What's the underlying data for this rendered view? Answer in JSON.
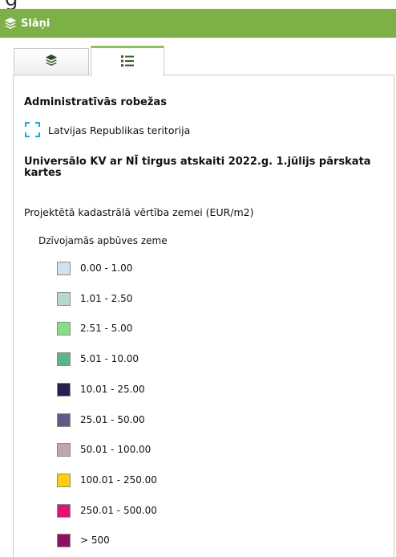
{
  "panel": {
    "title": "Slāņi"
  },
  "tabs": [
    {
      "icon": "layers-icon",
      "active": false
    },
    {
      "icon": "legend-list-icon",
      "active": true
    }
  ],
  "legend": {
    "section1_title": "Administratīvās robežas",
    "boundary_label": "Latvijas Republikas teritorija",
    "section2_title": "Universālo KV ar NĪ tirgus atskaiti 2022.g. 1.jūlijs pārskata kartes",
    "value_title": "Projektētā kadastrālā vērtība zemei (EUR/m2)",
    "group_title": "Dzīvojamās apbūves zeme",
    "classes": [
      {
        "label": "0.00 - 1.00",
        "color": "#cfe3f5"
      },
      {
        "label": "1.01 - 2.50",
        "color": "#b8d8c8"
      },
      {
        "label": "2.51 - 5.00",
        "color": "#86df86"
      },
      {
        "label": "5.01 - 10.00",
        "color": "#5ab582"
      },
      {
        "label": "10.01 - 25.00",
        "color": "#22224a"
      },
      {
        "label": "25.01 - 50.00",
        "color": "#5e5b88"
      },
      {
        "label": "50.01 - 100.00",
        "color": "#c4a2b6"
      },
      {
        "label": "100.01 - 250.00",
        "color": "#ffcf0a"
      },
      {
        "label": "250.01 - 500.00",
        "color": "#e0156e"
      },
      {
        "label": "> 500",
        "color": "#8e1064"
      }
    ]
  }
}
